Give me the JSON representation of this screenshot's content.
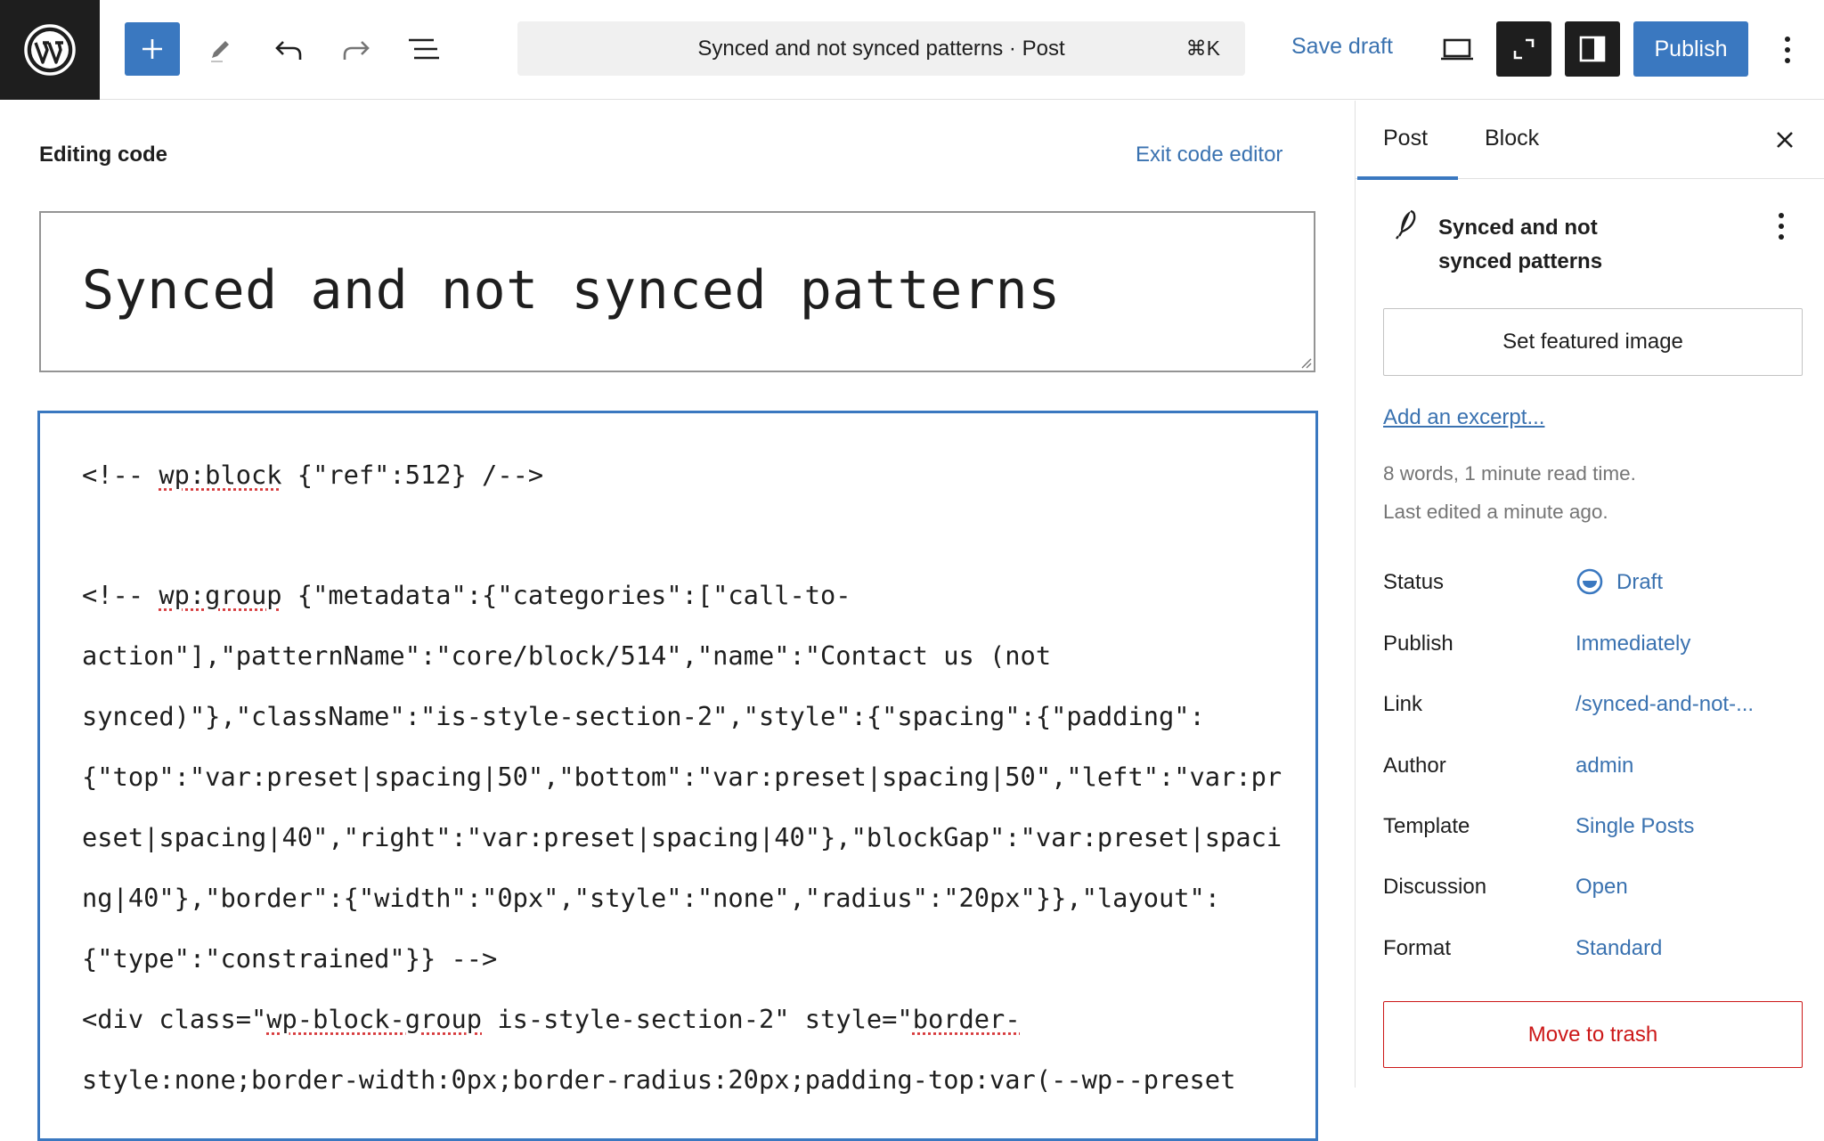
{
  "toolbar": {
    "command_bar_title": "Synced and not synced patterns · Post",
    "command_shortcut": "⌘K",
    "save_draft_label": "Save draft",
    "publish_label": "Publish",
    "accent_color": "#3a78c0"
  },
  "editor": {
    "mode_label": "Editing code",
    "exit_label": "Exit code editor",
    "title_value": "Synced and not synced patterns",
    "code_lines": [
      "<!-- wp:block {\"ref\":512} /-->",
      "",
      "<!-- wp:group {\"metadata\":{\"categories\":[\"call-to-",
      "action\"],\"patternName\":\"core/block/514\",\"name\":\"Contact us (not",
      "synced)\"},\"className\":\"is-style-section-2\",\"style\":{\"spacing\":{\"padding\":",
      "{\"top\":\"var:preset|spacing|50\",\"bottom\":\"var:preset|spacing|50\",\"left\":\"var:pr",
      "eset|spacing|40\",\"right\":\"var:preset|spacing|40\"},\"blockGap\":\"var:preset|spaci",
      "ng|40\"},\"border\":{\"width\":\"0px\",\"style\":\"none\",\"radius\":\"20px\"}},\"layout\":",
      "{\"type\":\"constrained\"}} -->",
      "<div class=\"wp-block-group is-style-section-2\" style=\"border-",
      "style:none;border-width:0px;border-radius:20px;padding-top:var(--wp--preset"
    ]
  },
  "sidebar": {
    "tabs": [
      {
        "label": "Post",
        "active": true
      },
      {
        "label": "Block",
        "active": false
      }
    ],
    "post_title_line1": "Synced and not",
    "post_title_line2": "synced patterns",
    "featured_image_label": "Set featured image",
    "excerpt_label": "Add an excerpt...",
    "word_count": "8 words, 1 minute read time.",
    "last_edited": "Last edited a minute ago.",
    "rows": [
      {
        "label": "Status",
        "value": "Draft"
      },
      {
        "label": "Publish",
        "value": "Immediately"
      },
      {
        "label": "Link",
        "value": "/synced-and-not-..."
      },
      {
        "label": "Author",
        "value": "admin"
      },
      {
        "label": "Template",
        "value": "Single Posts"
      },
      {
        "label": "Discussion",
        "value": "Open"
      },
      {
        "label": "Format",
        "value": "Standard"
      }
    ],
    "trash_label": "Move to trash",
    "danger_color": "#cc1818"
  }
}
